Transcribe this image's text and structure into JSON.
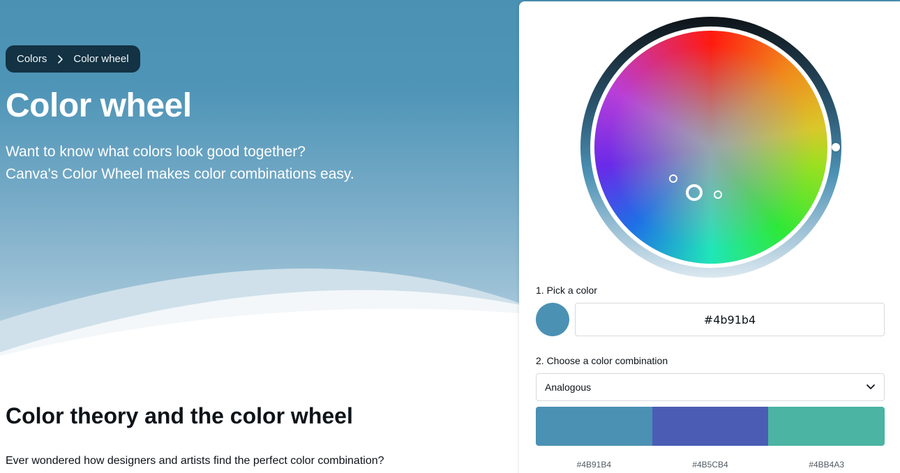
{
  "breadcrumb": {
    "items": [
      "Colors",
      "Color wheel"
    ]
  },
  "hero": {
    "title": "Color wheel",
    "description": "Want to know what colors look good together? Canva's Color Wheel makes color combinations easy."
  },
  "section": {
    "title": "Color theory and the color wheel",
    "text": "Ever wondered how designers and artists find the perfect color combination?"
  },
  "tool": {
    "step1_label": "1. Pick a color",
    "selected_color": "#4b91b4",
    "hex_value": "#4b91b4",
    "step2_label": "2. Choose a color combination",
    "combination": "Analogous",
    "palette": [
      "#4B91B4",
      "#4B5CB4",
      "#4BB4A3"
    ]
  },
  "colors": {
    "hero_background": "#4b91b4",
    "breadcrumb_background": "#0f2a3a",
    "text_dark": "#0e1318"
  },
  "icons": {
    "breadcrumb_separator": "chevron-right-icon",
    "select_arrow": "chevron-down-icon"
  }
}
